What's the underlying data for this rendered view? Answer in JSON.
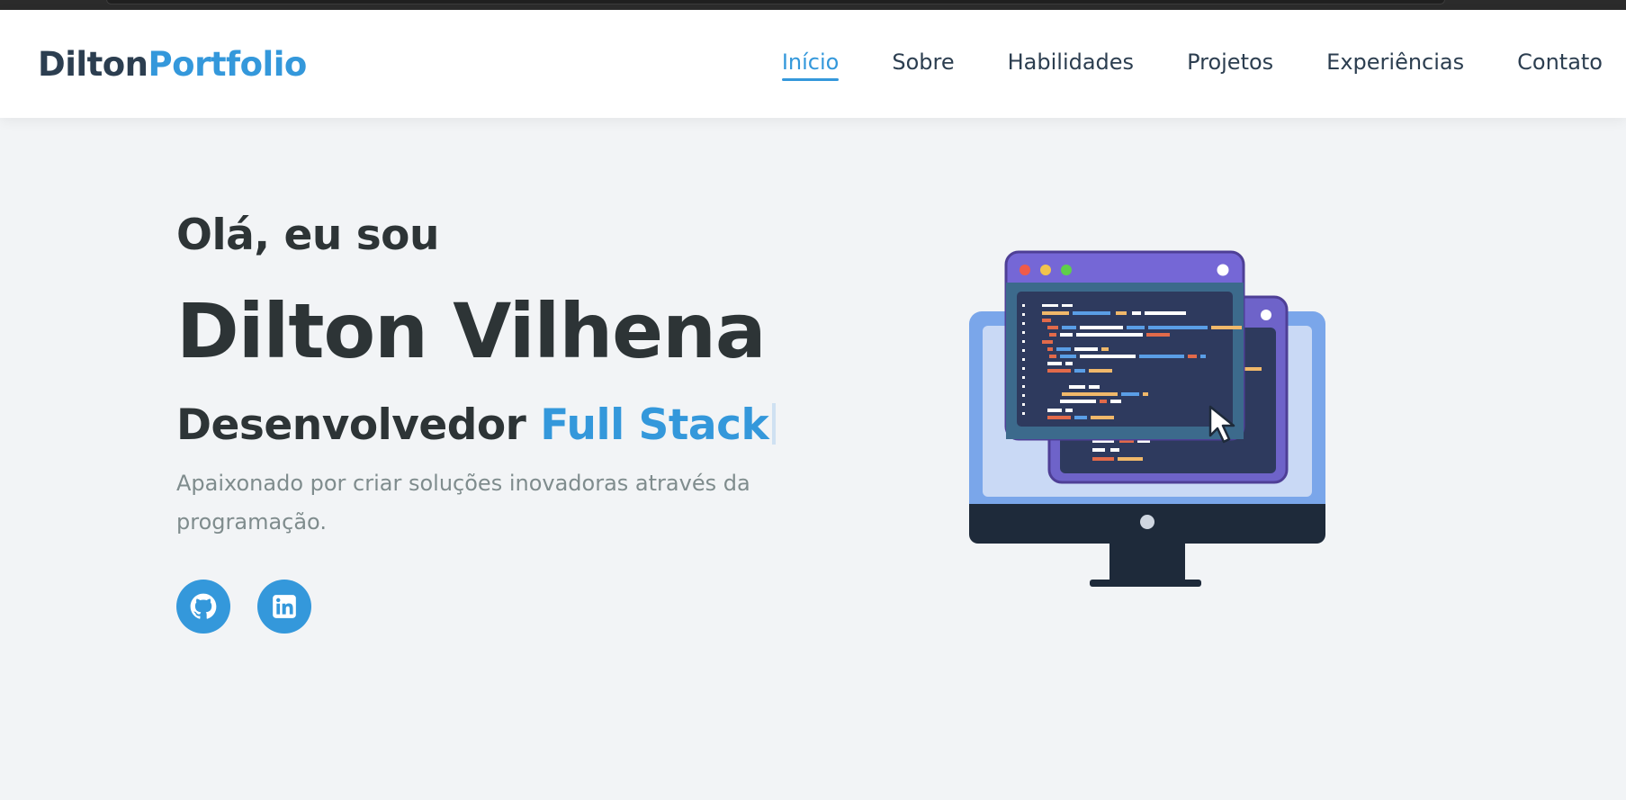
{
  "brand": {
    "part1": "Dilton",
    "part2": "Portfolio"
  },
  "nav": {
    "items": [
      {
        "label": "Início",
        "active": true
      },
      {
        "label": "Sobre"
      },
      {
        "label": "Habilidades"
      },
      {
        "label": "Projetos"
      },
      {
        "label": "Experiências"
      },
      {
        "label": "Contato"
      }
    ]
  },
  "hero": {
    "greeting": "Olá, eu sou",
    "name": "Dilton Vilhena",
    "role_prefix": "Desenvolvedor",
    "role_highlight": "Full Stack",
    "description": "Apaixonado por criar soluções inovadoras através da programação."
  },
  "socials": [
    {
      "icon": "github-icon"
    },
    {
      "icon": "linkedin-icon"
    }
  ],
  "colors": {
    "accent": "#3498db",
    "dark": "#2c3e50",
    "text": "#2d3436",
    "muted": "#7f8c8d",
    "background": "#f2f4f6"
  }
}
